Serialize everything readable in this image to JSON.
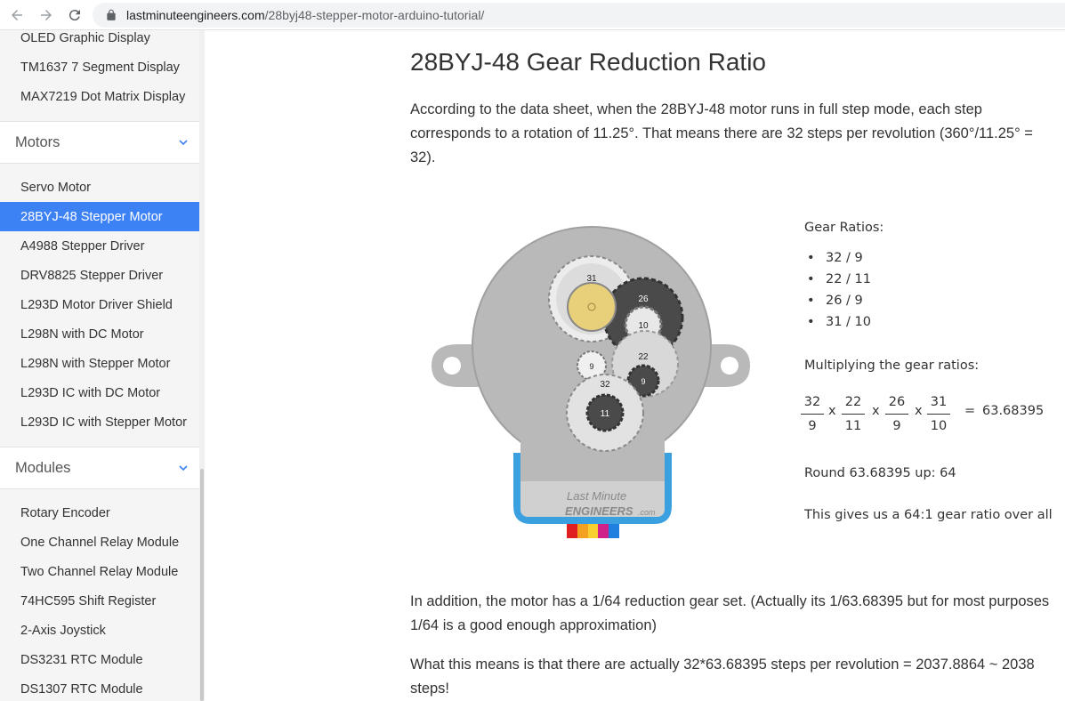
{
  "browser": {
    "url_host": "lastminuteengineers.com",
    "url_path": "/28byj48-stepper-motor-arduino-tutorial/"
  },
  "sidebar": {
    "top_items": [
      "OLED Graphic Display",
      "TM1637 7 Segment Display",
      "MAX7219 Dot Matrix Display"
    ],
    "motors_section": "Motors",
    "motors_items": [
      "Servo Motor",
      "28BYJ-48 Stepper Motor",
      "A4988 Stepper Driver",
      "DRV8825 Stepper Driver",
      "L293D Motor Driver Shield",
      "L298N with DC Motor",
      "L298N with Stepper Motor",
      "L293D IC with DC Motor",
      "L293D IC with Stepper Motor"
    ],
    "active_item": "28BYJ-48 Stepper Motor",
    "modules_section": "Modules",
    "modules_items": [
      "Rotary Encoder",
      "One Channel Relay Module",
      "Two Channel Relay Module",
      "74HC595 Shift Register",
      "2-Axis Joystick",
      "DS3231 RTC Module",
      "DS1307 RTC Module"
    ]
  },
  "content": {
    "heading": "28BYJ-48 Gear Reduction Ratio",
    "para1": "According to the data sheet, when the 28BYJ-48 motor runs in full step mode, each step corresponds to a rotation of 11.25°. That means there are 32 steps per revolution (360°/11.25° = 32).",
    "para2": "In addition, the motor has a 1/64 reduction gear set. (Actually its 1/63.68395 but for most purposes 1/64 is a good enough approximation)",
    "para3": "What this means is that there are actually 32*63.68395 steps per revolution = 2037.8864 ~ 2038 steps!"
  },
  "diagram": {
    "gear_labels": [
      "31",
      "26",
      "10",
      "22",
      "9",
      "9",
      "32",
      "11"
    ],
    "watermark_line1": "Last Minute",
    "watermark_line2": "ENGINEERS",
    "watermark_suffix": ".com",
    "colors": {
      "body": "#b9b9b9",
      "gear_light": "#ececec",
      "gear_dark": "#4a4a4a",
      "shaft": "#e8cf7a",
      "connector": "#3aa0e0"
    }
  },
  "gear_panel": {
    "title": "Gear Ratios:",
    "ratios": [
      "32 / 9",
      "22 / 11",
      "26 / 9",
      "31 / 10"
    ],
    "multiply_title": "Multiplying the gear ratios:",
    "fractions": [
      {
        "num": "32",
        "den": "9"
      },
      {
        "num": "22",
        "den": "11"
      },
      {
        "num": "26",
        "den": "9"
      },
      {
        "num": "31",
        "den": "10"
      }
    ],
    "operator": "x",
    "equals": "=",
    "result": "63.68395",
    "round_text": "Round 63.68395 up: 64",
    "gives_prefix": "This gives us a ",
    "gives_bold": "64:1",
    "gives_suffix": " gear ratio over all"
  }
}
